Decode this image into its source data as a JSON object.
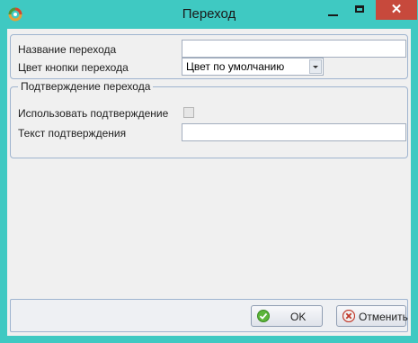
{
  "window": {
    "title": "Переход"
  },
  "form": {
    "name_label": "Название перехода",
    "name_value": "",
    "color_label": "Цвет кнопки перехода",
    "color_value": "Цвет по умолчанию"
  },
  "confirmation": {
    "group_title": "Подтверждение перехода",
    "use_label": "Использовать подтверждение",
    "use_checked": false,
    "text_label": "Текст подтверждения",
    "text_value": ""
  },
  "buttons": {
    "ok": "OK",
    "cancel": "Отменить"
  },
  "colors": {
    "frame": "#3fc9c2",
    "close": "#c7493c"
  }
}
